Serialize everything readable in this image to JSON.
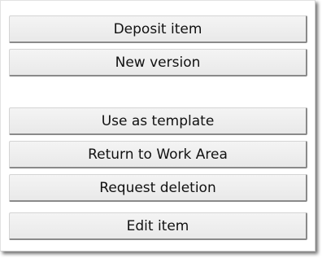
{
  "actions": {
    "deposit_item": "Deposit item",
    "new_version": "New version",
    "use_as_template": "Use as template",
    "return_to_work_area": "Return to Work Area",
    "request_deletion": "Request deletion",
    "edit_item": "Edit item"
  }
}
